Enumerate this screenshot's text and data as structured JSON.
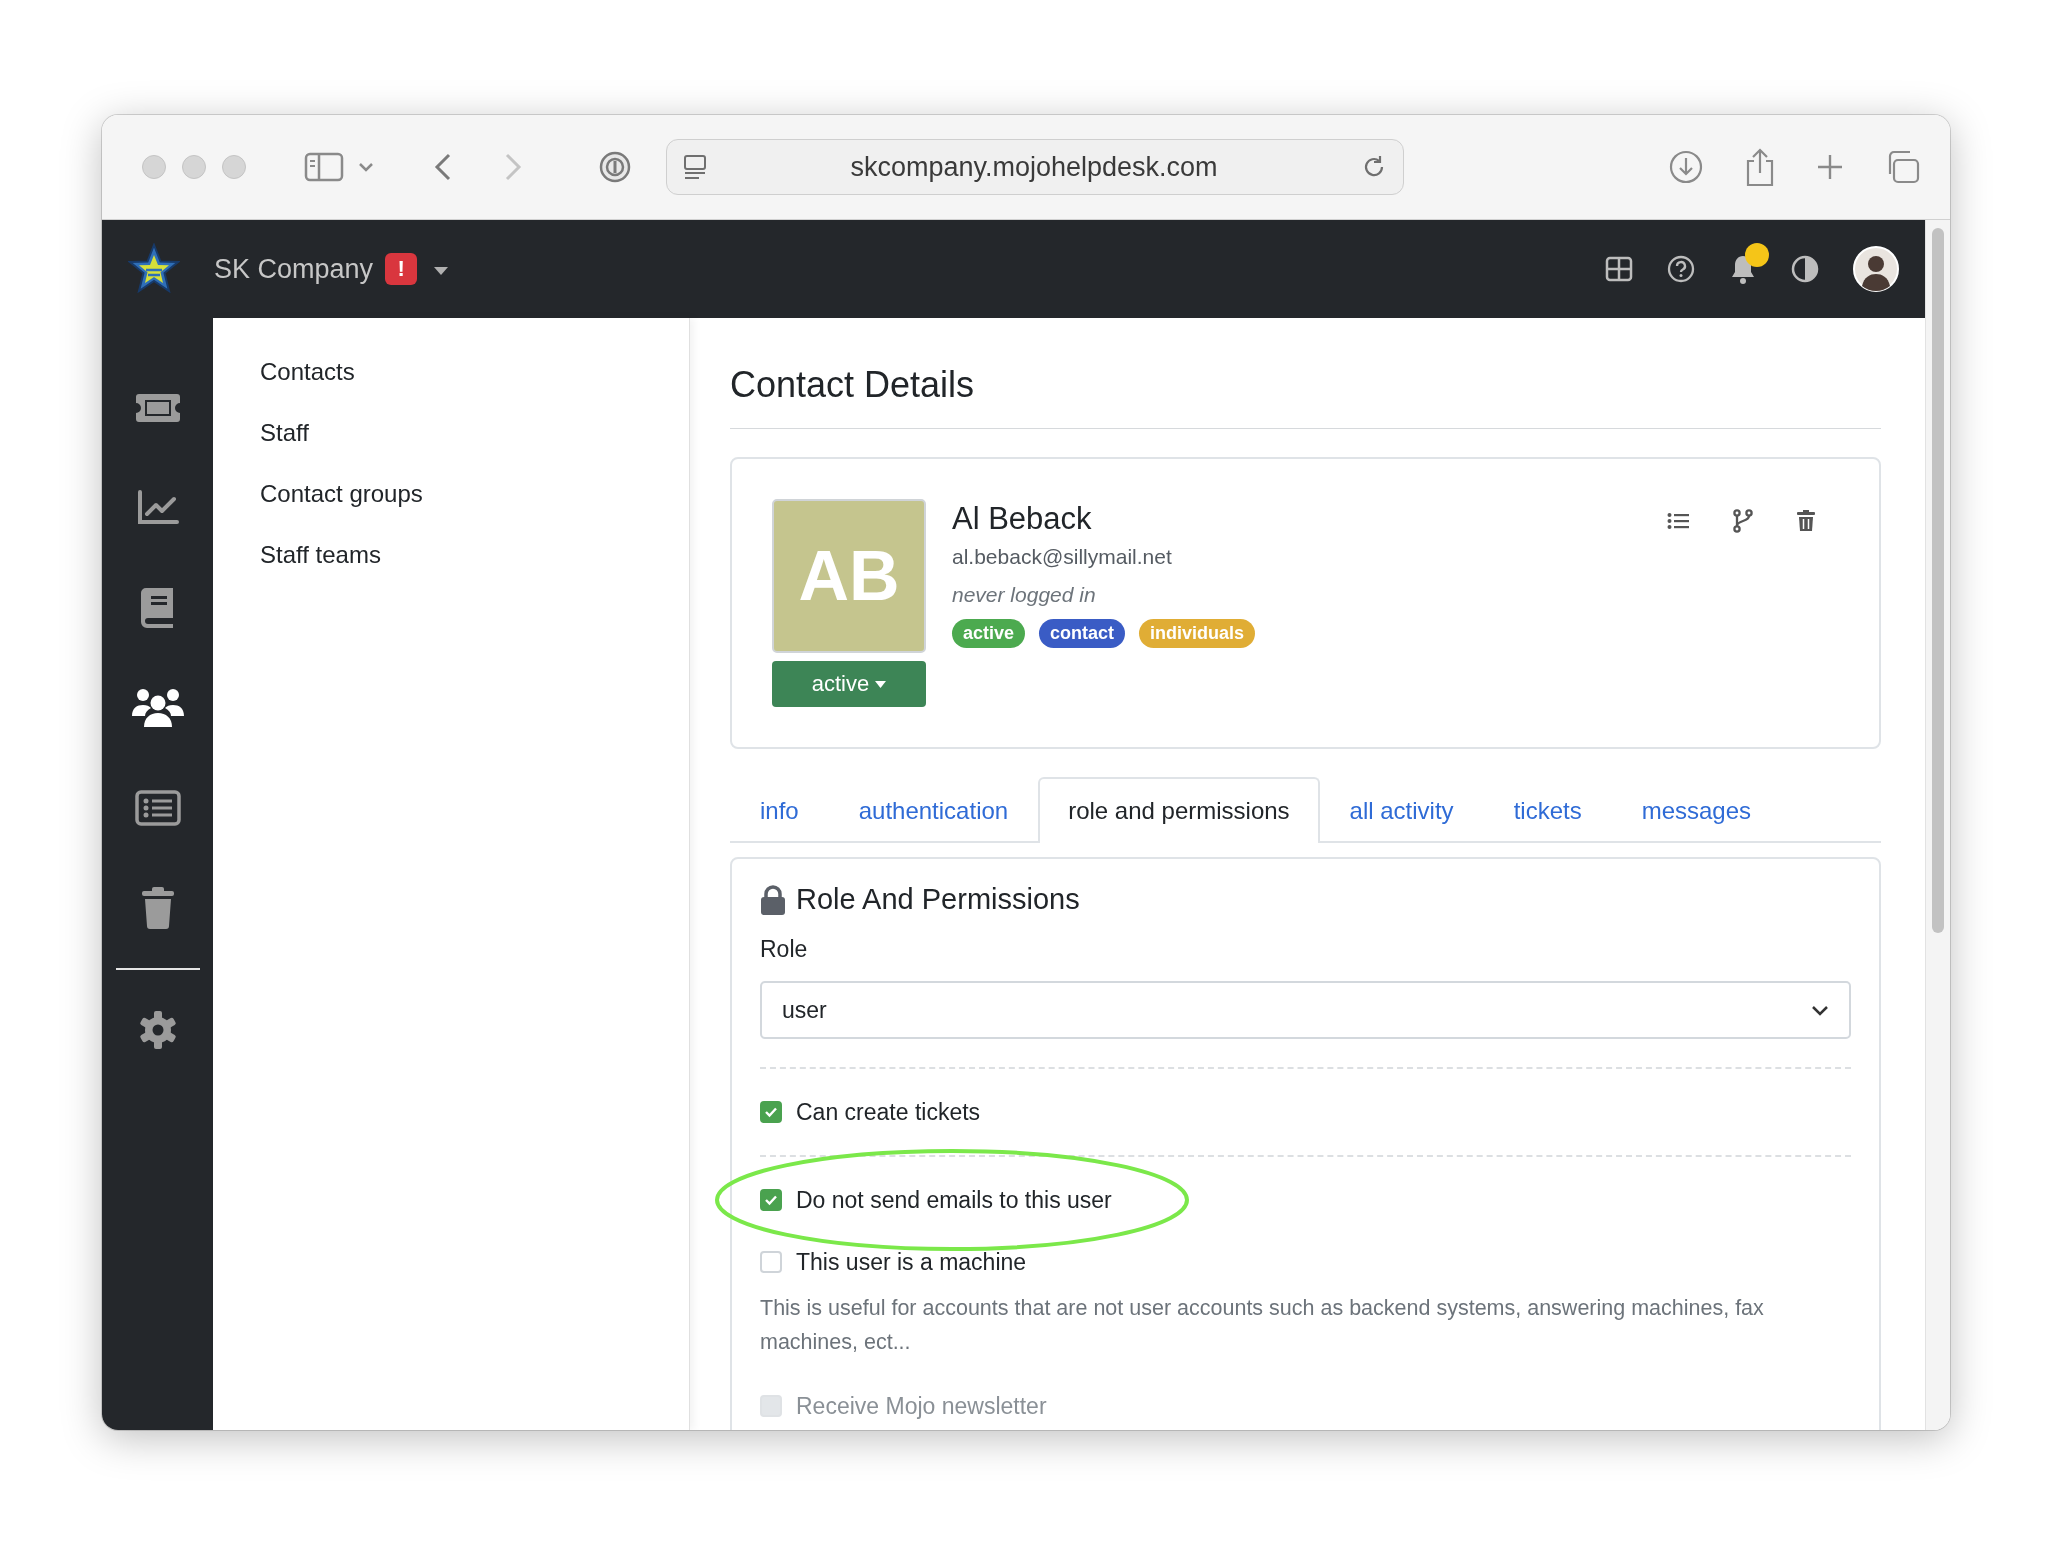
{
  "browser": {
    "url": "skcompany.mojohelpdesk.com"
  },
  "header": {
    "company": "SK Company",
    "alert_badge": "!",
    "notification_dot": true
  },
  "rail": [
    {
      "kind": "tickets",
      "selected": false
    },
    {
      "kind": "chart",
      "selected": false
    },
    {
      "kind": "book",
      "selected": false
    },
    {
      "kind": "people",
      "selected": true
    },
    {
      "kind": "list",
      "selected": false
    },
    {
      "kind": "trash",
      "selected": false
    },
    {
      "kind": "settings",
      "selected": false
    }
  ],
  "submenu": [
    "Contacts",
    "Staff",
    "Contact groups",
    "Staff teams"
  ],
  "page_title": "Contact Details",
  "contact": {
    "initials": "AB",
    "name": "Al Beback",
    "email": "al.beback@sillymail.net",
    "last_login": "never logged in",
    "status_button": "active",
    "tags": [
      {
        "label": "active",
        "color": "#4caa4f"
      },
      {
        "label": "contact",
        "color": "#3a5cc5"
      },
      {
        "label": "individuals",
        "color": "#e0ad35"
      }
    ]
  },
  "tabs": [
    {
      "label": "info",
      "selected": false
    },
    {
      "label": "authentication",
      "selected": false
    },
    {
      "label": "role and permissions",
      "selected": true
    },
    {
      "label": "all activity",
      "selected": false
    },
    {
      "label": "tickets",
      "selected": false
    },
    {
      "label": "messages",
      "selected": false
    }
  ],
  "section": {
    "title": "Role And Permissions",
    "role_label": "Role",
    "role_value": "user",
    "permissions": [
      {
        "label": "Can create tickets",
        "checked": true,
        "disabled": false,
        "divider_after": true
      },
      {
        "label": "Do not send emails to this user",
        "checked": true,
        "disabled": false,
        "highlighted": true,
        "divider_after": false
      },
      {
        "label": "This user is a machine",
        "checked": false,
        "disabled": false,
        "divider_after": false,
        "description": "This is useful for accounts that are not user accounts such as backend systems, answering machines, fax machines, ect..."
      },
      {
        "label": "Receive Mojo newsletter",
        "checked": false,
        "disabled": true,
        "divider_after": false
      }
    ]
  }
}
